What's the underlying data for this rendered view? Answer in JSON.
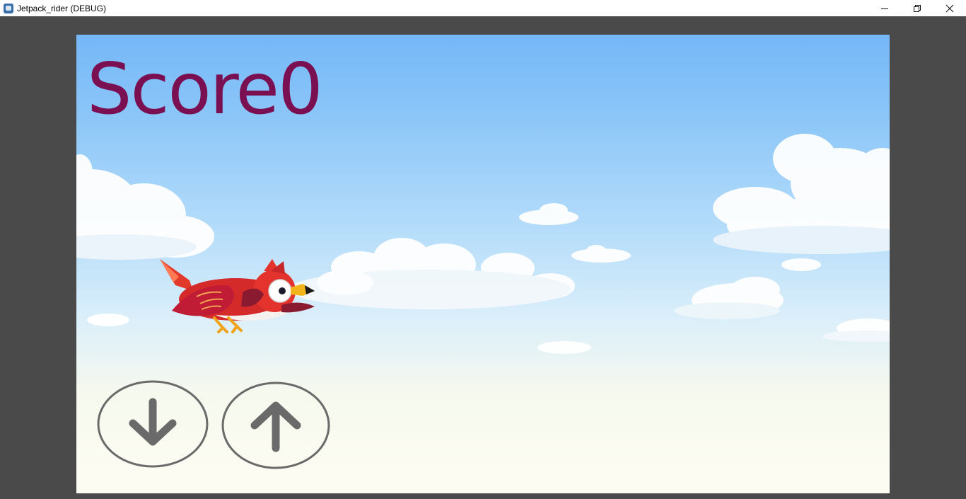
{
  "window": {
    "title": "Jetpack_rider (DEBUG)",
    "icon": "godot-app-icon",
    "controls": [
      "minimize-icon",
      "restore-icon",
      "close-icon"
    ]
  },
  "hud": {
    "score_text": "Score0",
    "score_color": "#7a0f52"
  },
  "scene": {
    "sky_top_color": "#74b7f7",
    "sky_bottom_color": "#fdfcf3",
    "player": "red-bird"
  },
  "controls": {
    "down_icon": "arrow-down-icon",
    "up_icon": "arrow-up-icon",
    "button_color": "#6a6a6a"
  }
}
